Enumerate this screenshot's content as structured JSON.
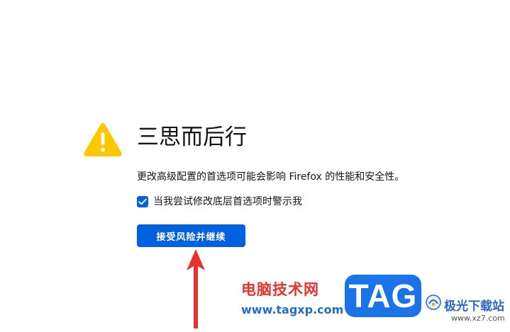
{
  "page": {
    "title": "三思而后行",
    "description": "更改高级配置的首选项可能会影响 Firefox 的性能和安全性。",
    "checkbox": {
      "label": "当我尝试修改底层首选项时警示我",
      "checked": true
    },
    "accept_button_label": "接受风险并继续"
  },
  "icons": {
    "warning": "warning-triangle-icon",
    "checkmark": "checkmark-icon"
  },
  "colors": {
    "accent": "#0061e0",
    "warning": "#ffc700",
    "text": "#15141a",
    "annotation": "#e8322b"
  },
  "watermark": {
    "site_name": "电脑技术网",
    "site_url": "www.tagxp.com",
    "logo_text": "TAG",
    "secondary_name": "极光下载站",
    "secondary_url": "www.xz7.com"
  }
}
